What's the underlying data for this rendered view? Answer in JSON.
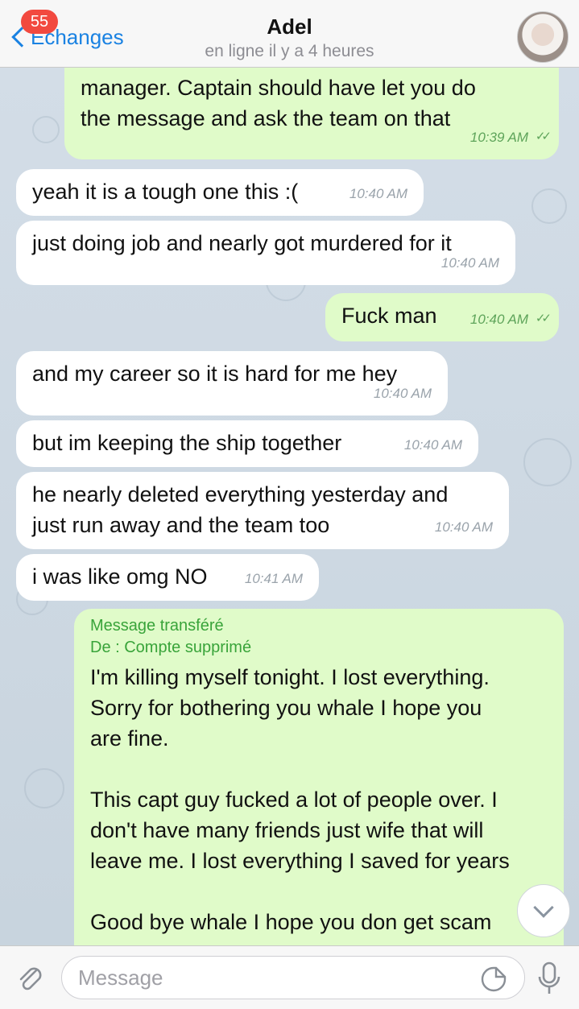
{
  "header": {
    "back_label": "Echanges",
    "unread_badge": "55",
    "title": "Adel",
    "subtitle": "en ligne il y a 4 heures"
  },
  "messages": [
    {
      "dir": "out",
      "text": "manager. Captain should have let you do\nthe message and ask the team on that",
      "time": "10:39 AM",
      "read": true
    },
    {
      "dir": "in",
      "text": "yeah it is a tough one this :(",
      "time": "10:40 AM"
    },
    {
      "dir": "in",
      "text": "just doing job and nearly got murdered for it",
      "time": "10:40 AM"
    },
    {
      "dir": "out",
      "text": "Fuck man",
      "time": "10:40 AM",
      "read": true
    },
    {
      "dir": "in",
      "text": "and my career so it is hard for me hey",
      "time": "10:40 AM"
    },
    {
      "dir": "in",
      "text": "but im keeping the ship together",
      "time": "10:40 AM"
    },
    {
      "dir": "in",
      "text": "he nearly deleted everything yesterday and\njust run away and the team too",
      "time": "10:40 AM"
    },
    {
      "dir": "in",
      "text": "i was like omg NO",
      "time": "10:41 AM"
    }
  ],
  "forwarded": {
    "label": "Message transféré",
    "from": "De : Compte supprimé",
    "text": "I'm killing myself tonight. I lost everything.\nSorry for bothering you whale I hope you\nare fine.\n\nThis capt guy fucked a lot of people over. I\ndon't have many friends just wife that will\nleave me. I lost everything I saved for years\n\nGood bye whale I hope you don get scam"
  },
  "input": {
    "placeholder": "Message"
  },
  "icons": {
    "attach": "paperclip-icon",
    "sticker": "sticker-icon",
    "mic": "microphone-icon",
    "scroll": "chevron-down-icon"
  },
  "colors": {
    "outgoing_bubble": "#e0fbc9",
    "incoming_bubble": "#ffffff",
    "accent": "#1a82e2",
    "badge": "#f2493f"
  }
}
